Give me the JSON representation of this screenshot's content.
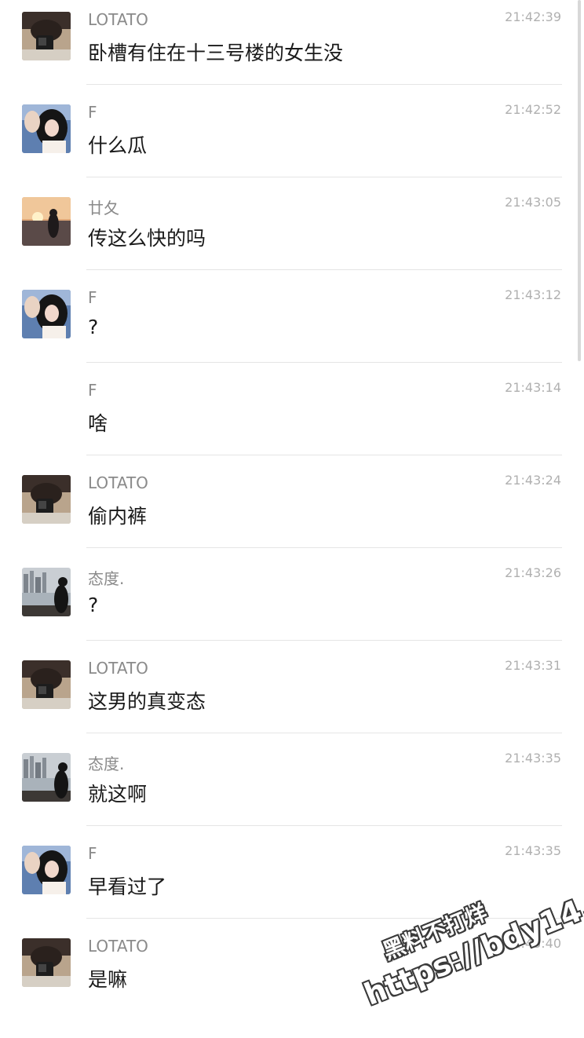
{
  "messages": [
    {
      "avatar": "avatar-lotato",
      "name": "LOTATO",
      "time": "21:42:39",
      "text": "卧槽有住在十三号楼的女生没"
    },
    {
      "avatar": "avatar-f",
      "name": "F",
      "time": "21:42:52",
      "text": "什么瓜"
    },
    {
      "avatar": "avatar-sunset",
      "name": "廿夂",
      "time": "21:43:05",
      "text": "传这么快的吗"
    },
    {
      "avatar": "avatar-f",
      "name": "F",
      "time": "21:43:12",
      "text": "?"
    },
    {
      "avatar": "none",
      "name": "F",
      "time": "21:43:14",
      "text": "啥"
    },
    {
      "avatar": "avatar-lotato",
      "name": "LOTATO",
      "time": "21:43:24",
      "text": "偷内裤"
    },
    {
      "avatar": "avatar-city",
      "name": "态度.",
      "time": "21:43:26",
      "text": "?"
    },
    {
      "avatar": "avatar-lotato",
      "name": "LOTATO",
      "time": "21:43:31",
      "text": "这男的真变态"
    },
    {
      "avatar": "avatar-city",
      "name": "态度.",
      "time": "21:43:35",
      "text": "就这啊"
    },
    {
      "avatar": "avatar-f",
      "name": "F",
      "time": "21:43:35",
      "text": "早看过了"
    },
    {
      "avatar": "avatar-lotato",
      "name": "LOTATO",
      "time": "21:43:40",
      "text": "是嘛"
    }
  ],
  "watermark": {
    "line1": "黑料不打烊",
    "line2": "https://bdy14.co"
  }
}
